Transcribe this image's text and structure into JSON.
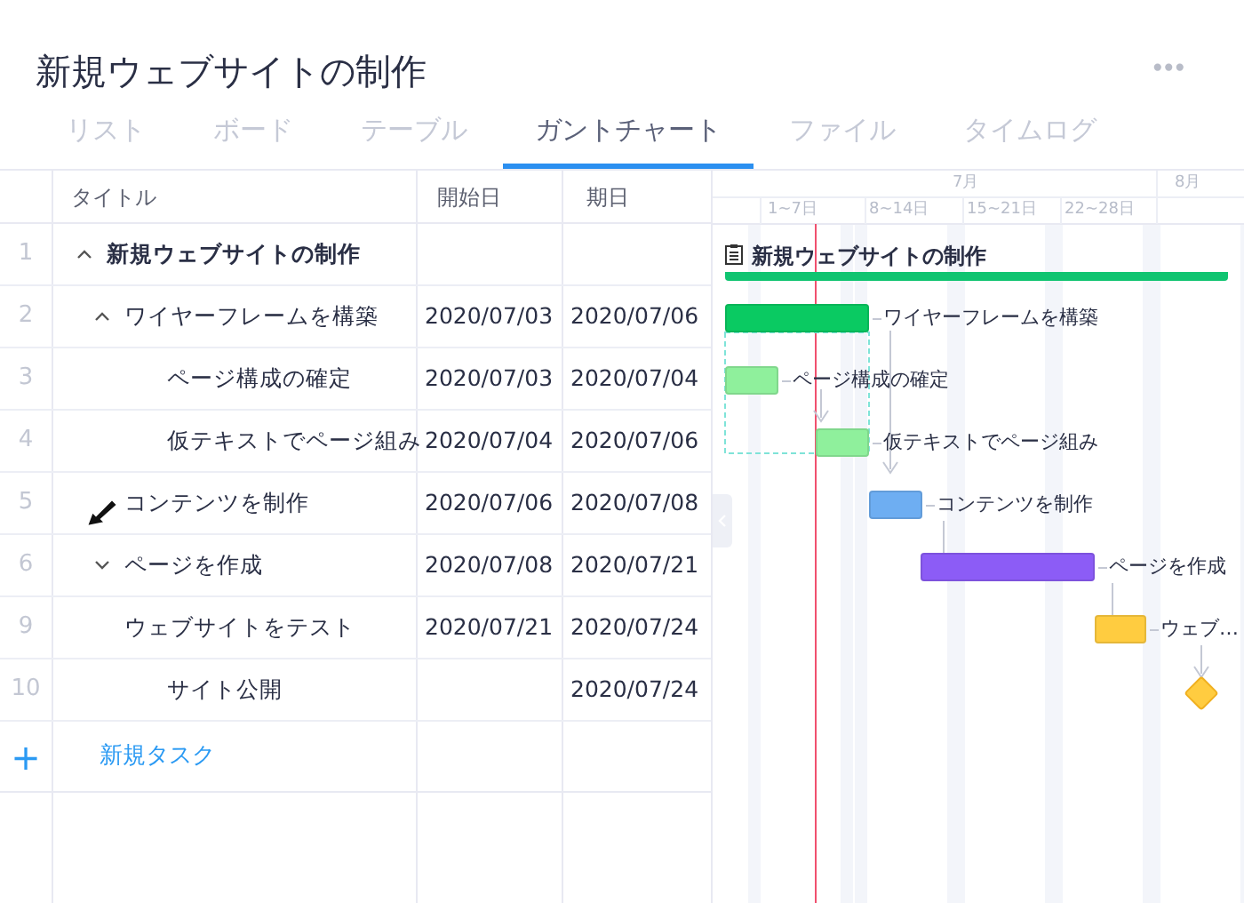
{
  "project": {
    "title": "新規ウェブサイトの制作",
    "more": "•••"
  },
  "tabs": [
    {
      "label": "リスト",
      "selected": false
    },
    {
      "label": "ボード",
      "selected": false
    },
    {
      "label": "テーブル",
      "selected": false
    },
    {
      "label": "ガントチャート",
      "selected": true
    },
    {
      "label": "ファイル",
      "selected": false
    },
    {
      "label": "タイムログ",
      "selected": false
    }
  ],
  "table": {
    "columns": [
      "タイトル",
      "開始日",
      "期日"
    ],
    "rows": [
      {
        "number": "1",
        "title": "新規ウェブサイトの制作",
        "expanded": true,
        "kind": "summary",
        "color": "#10c471",
        "bar_label": "新規ウェブサイトの制作",
        "children": [
          {
            "number": "2",
            "title": "ワイヤーフレームを構築",
            "start": "2020/07/03",
            "due": "2020/07/06",
            "expanded": true,
            "kind": "task",
            "color": "#0aca62",
            "bar_label": "ワイヤーフレームを構築",
            "children": [
              {
                "number": "3",
                "title": "ページ構成の確定",
                "start": "2020/07/03",
                "due": "2020/07/04",
                "kind": "task",
                "color": "#8ff09c",
                "bar_label": "ページ構成の確定"
              },
              {
                "number": "4",
                "title": "仮テキストでページ組み",
                "start": "2020/07/04",
                "due": "2020/07/06",
                "kind": "task",
                "color": "#8ff09c",
                "bar_label": "仮テキストでページ組み"
              }
            ]
          },
          {
            "number": "5",
            "title": "コンテンツを制作",
            "start": "2020/07/06",
            "due": "2020/07/08",
            "kind": "task",
            "color": "#6eaef2",
            "bar_label": "コンテンツを制作"
          },
          {
            "number": "6",
            "title": "ページを作成",
            "start": "2020/07/08",
            "due": "2020/07/21",
            "expanded": false,
            "kind": "task",
            "color": "#8c5cf6",
            "bar_label": "ページを作成"
          },
          {
            "number": "9",
            "title": "ウェブサイトをテスト",
            "start": "2020/07/21",
            "due": "2020/07/24",
            "kind": "task",
            "color": "#ffcc40",
            "bar_label": "ウェブ…",
            "children": [
              {
                "number": "10",
                "title": "サイト公開",
                "due": "2020/07/24",
                "kind": "milestone",
                "color": "#ffcc40"
              }
            ]
          }
        ]
      }
    ],
    "new_task": {
      "icon": "+",
      "label": "新規タスク"
    }
  },
  "timeline": {
    "months": [
      "7月",
      "8月"
    ],
    "weeks": [
      "1~7日",
      "8~14日",
      "15~21日",
      "22~28日"
    ]
  }
}
